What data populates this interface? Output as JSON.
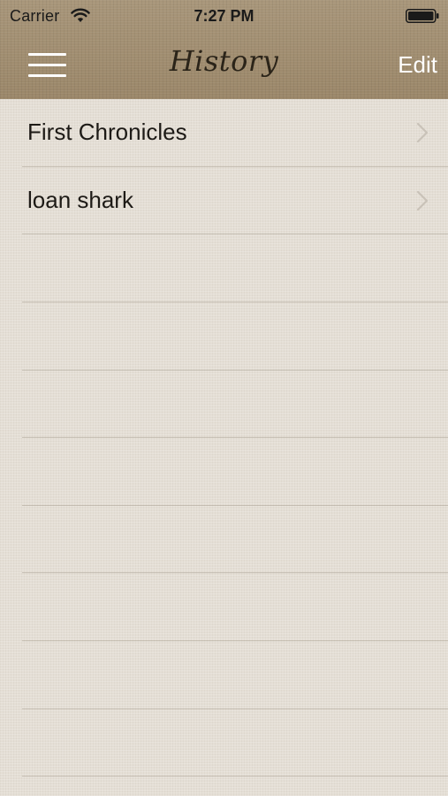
{
  "status_bar": {
    "carrier": "Carrier",
    "time": "7:27 PM",
    "wifi_icon": "wifi-icon",
    "battery_icon": "battery-icon"
  },
  "nav_bar": {
    "title": "History",
    "edit_label": "Edit",
    "menu_icon": "hamburger-menu-icon"
  },
  "history": {
    "items": [
      {
        "label": "First Chronicles"
      },
      {
        "label": "loan shark"
      }
    ],
    "empty_rows": 8
  },
  "colors": {
    "header_bg": "#a08d70",
    "content_bg": "#e4ded5",
    "title_text": "#2b2419",
    "edit_text": "#ffffff",
    "row_text": "#1d1a16",
    "chevron": "#c9c2b8"
  }
}
